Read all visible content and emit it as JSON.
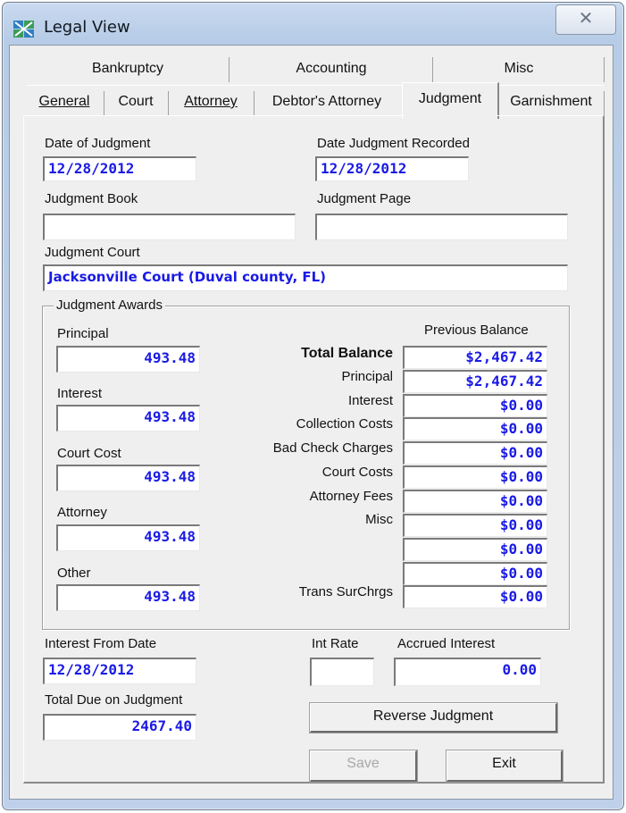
{
  "window": {
    "title": "Legal View",
    "close_glyph": "✕"
  },
  "tabs": {
    "row1": [
      "Bankruptcy",
      "Accounting",
      "Misc"
    ],
    "row2": [
      "General",
      "Court",
      "Attorney",
      "Debtor's Attorney",
      "Judgment",
      "Garnishment"
    ],
    "active": "Judgment"
  },
  "form": {
    "date_of_judgment_label": "Date of Judgment",
    "date_of_judgment": "12/28/2012",
    "date_recorded_label": "Date Judgment Recorded",
    "date_recorded": "12/28/2012",
    "judgment_book_label": "Judgment Book",
    "judgment_book": "",
    "judgment_page_label": "Judgment Page",
    "judgment_page": "",
    "judgment_court_label": "Judgment Court",
    "judgment_court": "Jacksonville Court (Duval county, FL)"
  },
  "awards": {
    "group_title": "Judgment Awards",
    "principal_label": "Principal",
    "principal": "493.48",
    "interest_label": "Interest",
    "interest": "493.48",
    "court_cost_label": "Court Cost",
    "court_cost": "493.48",
    "attorney_label": "Attorney",
    "attorney": "493.48",
    "other_label": "Other",
    "other": "493.48"
  },
  "balances": {
    "header": "Previous Balance",
    "rows": [
      {
        "label": "Total Balance",
        "value": "$2,467.42"
      },
      {
        "label": "Principal",
        "value": "$2,467.42"
      },
      {
        "label": "Interest",
        "value": "$0.00"
      },
      {
        "label": "Collection Costs",
        "value": "$0.00"
      },
      {
        "label": "Bad Check Charges",
        "value": "$0.00"
      },
      {
        "label": "Court Costs",
        "value": "$0.00"
      },
      {
        "label": "Attorney Fees",
        "value": "$0.00"
      },
      {
        "label": "Misc",
        "value": "$0.00"
      },
      {
        "label": "",
        "value": "$0.00"
      },
      {
        "label": "",
        "value": "$0.00"
      },
      {
        "label": "Trans SurChrgs",
        "value": "$0.00"
      }
    ]
  },
  "bottom": {
    "interest_from_label": "Interest From Date",
    "interest_from": "12/28/2012",
    "int_rate_label": "Int Rate",
    "int_rate": "",
    "accrued_label": "Accrued Interest",
    "accrued": "0.00",
    "total_due_label": "Total Due on Judgment",
    "total_due": "2467.40",
    "reverse_button": "Reverse Judgment",
    "save_button": "Save",
    "exit_button": "Exit"
  },
  "colors": {
    "value_text": "#1a1ae6",
    "titlebar": "#c9daf0"
  }
}
